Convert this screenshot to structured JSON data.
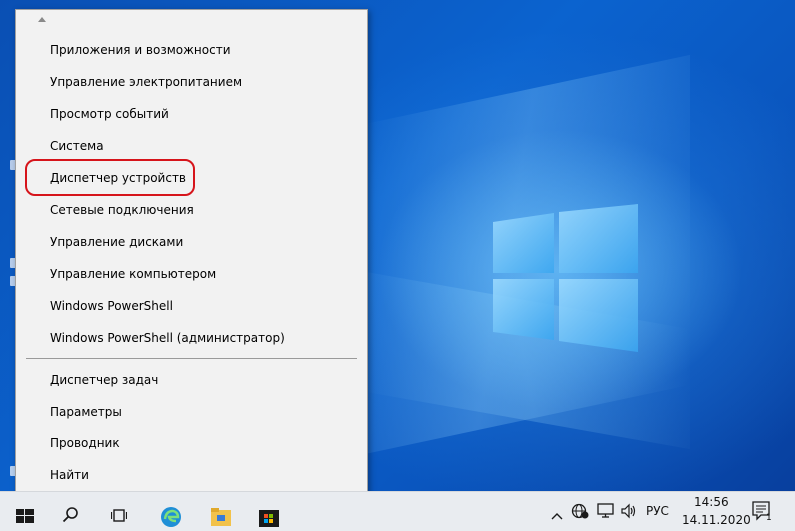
{
  "context_menu": {
    "items": [
      {
        "label": "Приложения и возможности"
      },
      {
        "label": "Управление электропитанием"
      },
      {
        "label": "Просмотр событий"
      },
      {
        "label": "Система"
      },
      {
        "label": "Диспетчер устройств",
        "highlighted": true
      },
      {
        "label": "Сетевые подключения"
      },
      {
        "label": "Управление дисками"
      },
      {
        "label": "Управление компьютером"
      },
      {
        "label": "Windows PowerShell"
      },
      {
        "label": "Windows PowerShell (администратор)"
      },
      {
        "label": "Диспетчер задач"
      },
      {
        "label": "Параметры"
      },
      {
        "label": "Проводник"
      },
      {
        "label": "Найти"
      }
    ],
    "highlight_color": "#d6141b"
  },
  "taskbar": {
    "language": "РУС",
    "time": "14:56",
    "date": "14.11.2020",
    "notification_badge": "1",
    "icons": [
      "windows-start-icon",
      "search-icon",
      "task-view-icon",
      "edge-icon",
      "file-explorer-icon",
      "store-icon"
    ],
    "tray_icons": [
      "chevron-up-icon",
      "network-icon",
      "display-icon",
      "volume-icon",
      "notification-icon"
    ]
  },
  "colors": {
    "desktop_blue": "#0b5ec4",
    "menu_bg": "#f2f2f2",
    "taskbar_bg": "#e9ecf0"
  }
}
